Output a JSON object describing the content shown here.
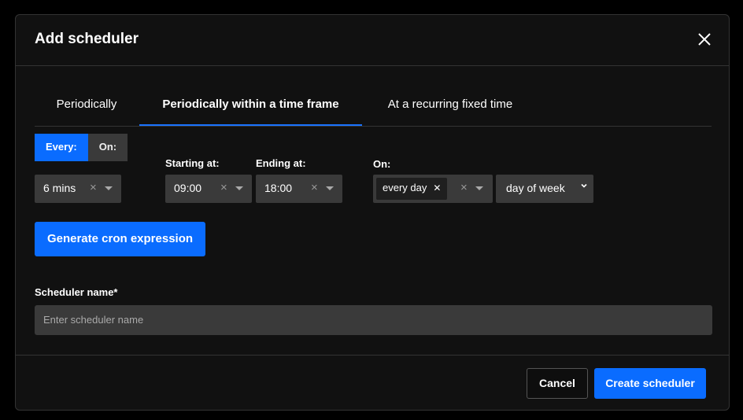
{
  "dialog": {
    "title": "Add scheduler"
  },
  "tabs": [
    {
      "label": "Periodically"
    },
    {
      "label": "Periodically within a time frame"
    },
    {
      "label": "At a recurring fixed time"
    }
  ],
  "mode_toggle": {
    "every_label": "Every:",
    "on_label": "On:",
    "selected": "Every:"
  },
  "interval": {
    "value": "6 mins"
  },
  "starting_at": {
    "label": "Starting at:",
    "value": "09:00"
  },
  "ending_at": {
    "label": "Ending at:",
    "value": "18:00"
  },
  "on": {
    "label": "On:",
    "chip": "every day",
    "mode": "day of week"
  },
  "generate_button": {
    "label": "Generate cron expression"
  },
  "scheduler_name": {
    "label": "Scheduler name*",
    "placeholder": "Enter scheduler name",
    "value": ""
  },
  "footer": {
    "cancel_label": "Cancel",
    "create_label": "Create scheduler"
  },
  "colors": {
    "accent": "#0a6cff",
    "modal_bg": "#111111",
    "field_bg": "#3a3a3a"
  }
}
